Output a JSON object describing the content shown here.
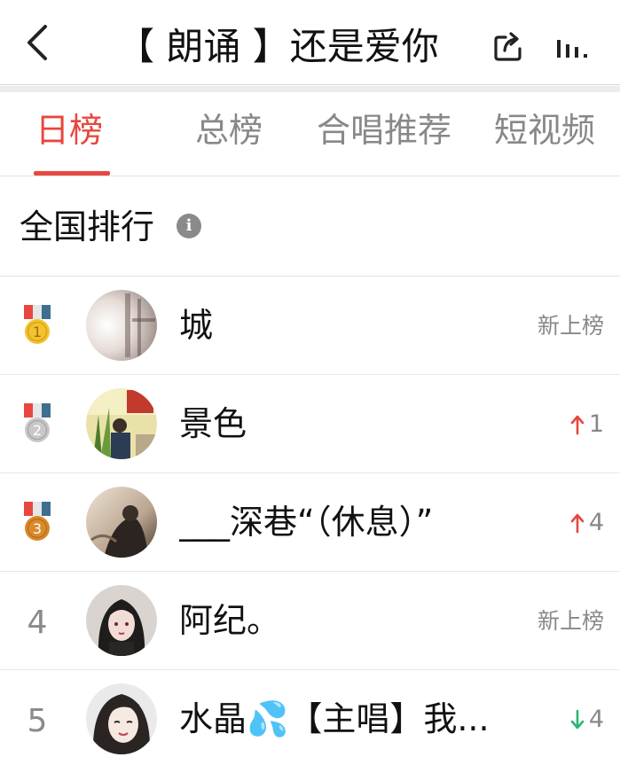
{
  "header": {
    "title": "【 朗诵 】还是爱你",
    "back_icon": "chevron-left-icon",
    "share_icon": "share-icon",
    "playing_icon": "now-playing-bars-icon"
  },
  "tabs": [
    {
      "label": "日榜",
      "active": true
    },
    {
      "label": "总榜",
      "active": false
    },
    {
      "label": "合唱推荐",
      "active": false
    },
    {
      "label": "短视频",
      "active": false
    }
  ],
  "section": {
    "title": "全国排行",
    "info_icon": "info-icon",
    "info_glyph": "i"
  },
  "rankings": [
    {
      "rank": "1",
      "medal": "gold",
      "name": "城",
      "change_type": "new",
      "change_text": "新上榜",
      "change_value": ""
    },
    {
      "rank": "2",
      "medal": "silver",
      "name": "景色",
      "change_type": "up",
      "change_text": "",
      "change_value": "1"
    },
    {
      "rank": "3",
      "medal": "bronze",
      "name": "___深巷“（休息）”",
      "change_type": "up",
      "change_text": "",
      "change_value": "4"
    },
    {
      "rank": "4",
      "medal": "",
      "name": "阿纪。",
      "change_type": "new",
      "change_text": "新上榜",
      "change_value": ""
    },
    {
      "rank": "5",
      "medal": "",
      "name": "水晶💦【主唱】我...",
      "change_type": "down",
      "change_text": "",
      "change_value": "4"
    }
  ],
  "colors": {
    "accent": "#e8473f",
    "up": "#e8473f",
    "down": "#2bb673",
    "gold": "#f2c230",
    "silver": "#c8c8c8",
    "bronze": "#d98a2b",
    "ribbon_red": "#e8473f",
    "ribbon_blue": "#3e6f8f"
  }
}
